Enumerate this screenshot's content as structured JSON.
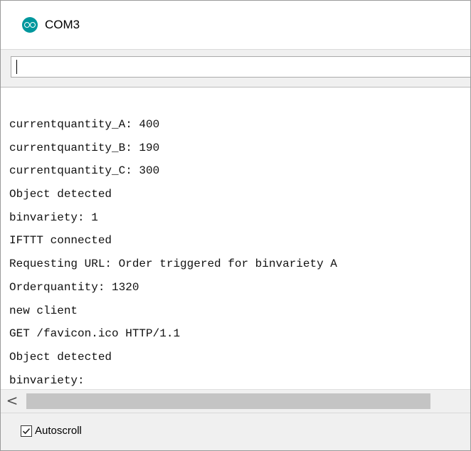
{
  "window": {
    "title": "COM3",
    "app_icon": "arduino-icon",
    "accent": "#00979d"
  },
  "send": {
    "value": ""
  },
  "output": {
    "lines": [
      "currentquantity_A: 400",
      "currentquantity_B: 190",
      "currentquantity_C: 300",
      "Object detected",
      "binvariety: 1",
      "IFTTT connected",
      "Requesting URL: Order triggered for binvariety A",
      "Orderquantity: 1320",
      "new client",
      "GET /favicon.ico HTTP/1.1",
      "Object detected",
      "binvariety:"
    ]
  },
  "scrollbar": {
    "left_arrow": "<"
  },
  "footer": {
    "autoscroll_label": "Autoscroll",
    "autoscroll_checked": true
  }
}
